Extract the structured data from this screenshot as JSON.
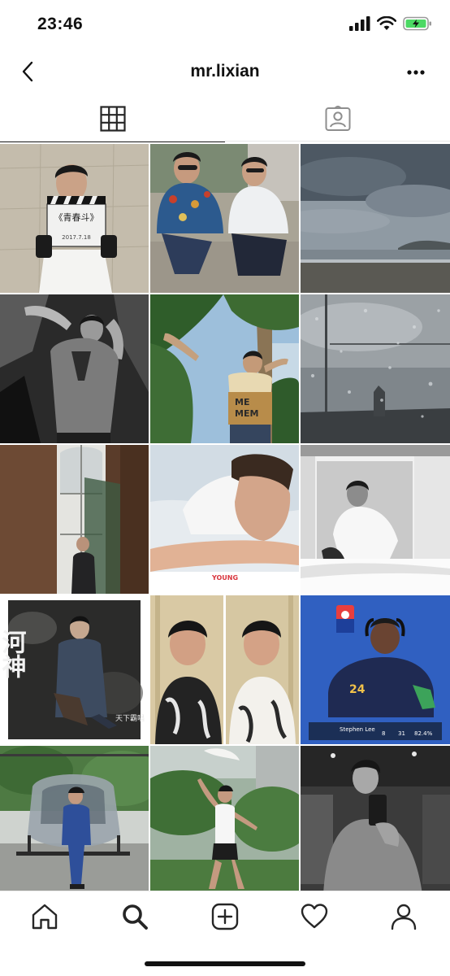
{
  "status_bar": {
    "time": "23:46",
    "icons": [
      "signal-icon",
      "wifi-icon",
      "battery-charging-icon"
    ],
    "battery_color": "#4cd964"
  },
  "header": {
    "username": "mr.lixian",
    "back_icon": "chevron-left-icon",
    "more_icon": "more-horizontal-icon"
  },
  "tabs": [
    {
      "icon": "grid-icon",
      "active": true
    },
    {
      "icon": "tagged-person-icon",
      "active": false
    }
  ],
  "grid": {
    "clapperboard_text": [
      "《青春斗》",
      "2017.7.18"
    ],
    "poster_title": "河神",
    "poster_credit": "天下霸唱",
    "magazine_logo": "YOUNG",
    "game_player": {
      "name": "Stephen Lee",
      "number": "24",
      "stats": [
        "8",
        "31",
        "82.4%"
      ]
    }
  },
  "bottom_nav": [
    {
      "icon": "home-icon",
      "active": false
    },
    {
      "icon": "search-icon",
      "active": true
    },
    {
      "icon": "add-post-icon",
      "active": false
    },
    {
      "icon": "heart-icon",
      "active": false
    },
    {
      "icon": "profile-icon",
      "active": false
    }
  ]
}
